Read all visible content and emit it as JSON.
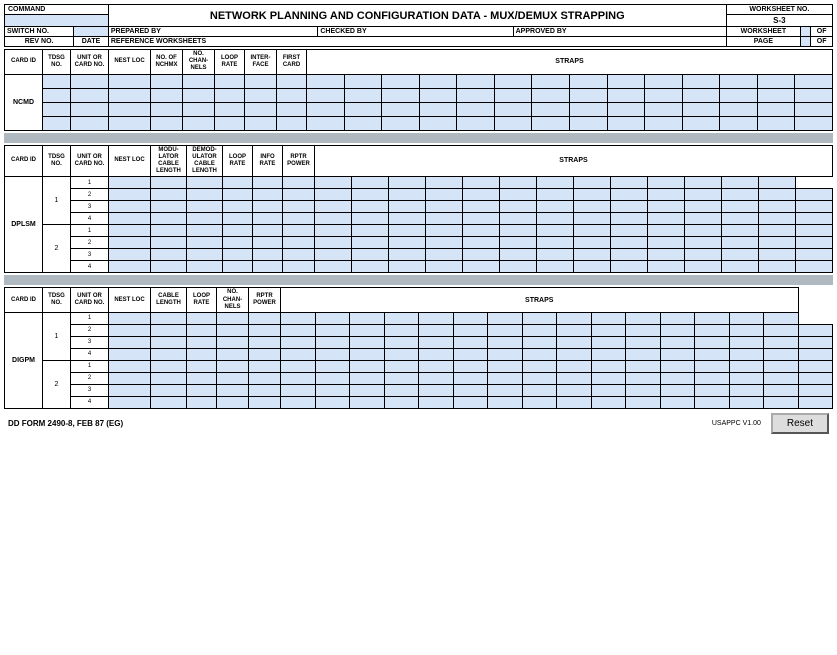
{
  "title": "NETWORK PLANNING AND CONFIGURATION DATA - MUX/DEMUX  STRAPPING",
  "worksheet_no_label": "WORKSHEET NO.",
  "worksheet_no_value": "S-3",
  "worksheet_label": "WORKSHEET",
  "of_label": "OF",
  "page_label": "PAGE",
  "page_of_label": "OF",
  "command_label": "COMMAND",
  "switch_no_label": "SWITCH NO.",
  "prepared_by_label": "PREPARED BY",
  "checked_by_label": "CHECKED BY",
  "approved_by_label": "APPROVED BY",
  "rev_no_label": "REV NO.",
  "date_label": "DATE",
  "reference_worksheets_label": "REFERENCE WORKSHEETS",
  "section1": {
    "label": "NCMD",
    "headers": {
      "card_id": "CARD ID",
      "tdsg_no": "TDSG NO.",
      "unit_or_card_no": "UNIT OR CARD NO.",
      "nest_loc": "NEST LOC",
      "no_of_nchmx": "NO. OF NCHMX",
      "no_channels": "NO. CHAN-NELS",
      "loop_rate": "LOOP RATE",
      "interface": "INTER-FACE",
      "first_card": "FIRST CARD",
      "straps": "STRAPS"
    },
    "rows": [
      {
        "cells": [
          "",
          "",
          "",
          "",
          "",
          "",
          "",
          "",
          ""
        ]
      },
      {
        "cells": [
          "",
          "",
          "",
          "",
          "",
          "",
          "",
          "",
          ""
        ]
      },
      {
        "cells": [
          "",
          "",
          "",
          "",
          "",
          "",
          "",
          "",
          ""
        ]
      },
      {
        "cells": [
          "",
          "",
          "",
          "",
          "",
          "",
          "",
          "",
          ""
        ]
      }
    ]
  },
  "section2": {
    "label": "DPLSM",
    "headers": {
      "card_id": "CARD ID",
      "tdsg_no": "TDSG NO.",
      "unit_or_card_no": "UNIT OR CARD NO.",
      "nest_loc": "NEST LOC",
      "modu_lator_cable_length": "MODU-LATOR CABLE LENGTH",
      "demod_ulator_cable_length": "DEMOD-ULATOR CABLE LENGTH",
      "loop_rate": "LOOP RATE",
      "info_rate": "INFO RATE",
      "rptr_power": "RPTR POWER",
      "straps": "STRAPS"
    },
    "groups": [
      {
        "group_num": "1",
        "rows": [
          "1",
          "2",
          "3",
          "4"
        ]
      },
      {
        "group_num": "2",
        "rows": [
          "1",
          "2",
          "3",
          "4"
        ]
      }
    ]
  },
  "section3": {
    "label": "DIGPM",
    "headers": {
      "card_id": "CARD ID",
      "tdsg_no": "TDSG NO.",
      "unit_or_card_no": "UNIT OR CARD NO.",
      "nest_loc": "NEST LOC",
      "cable_length": "CABLE LENGTH",
      "loop_rate": "LOOP RATE",
      "no_channels": "NO. CHAN-NELS",
      "rptr_power": "RPTR POWER",
      "straps": "STRAPS"
    },
    "groups": [
      {
        "group_num": "1",
        "rows": [
          "1",
          "2",
          "3",
          "4"
        ]
      },
      {
        "group_num": "2",
        "rows": [
          "1",
          "2",
          "3",
          "4"
        ]
      }
    ]
  },
  "footer": {
    "form_label": "DD FORM 2490-8, FEB 87 (EG)",
    "version": "USAPPC V1.00",
    "reset_label": "Reset"
  }
}
